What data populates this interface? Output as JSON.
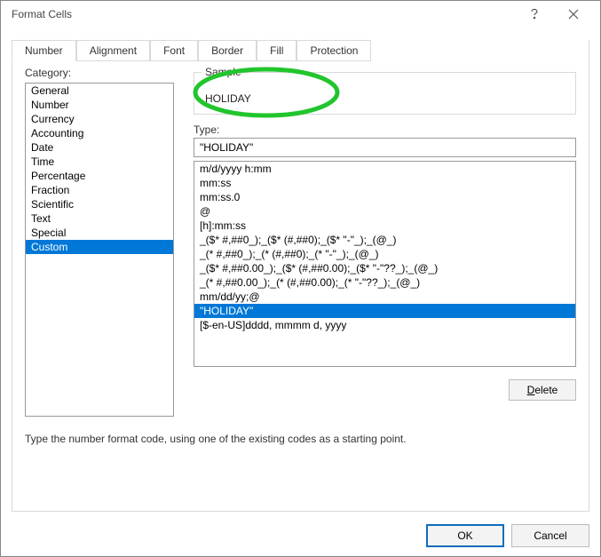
{
  "window": {
    "title": "Format Cells"
  },
  "tabs": {
    "number": "Number",
    "alignment": "Alignment",
    "font": "Font",
    "border": "Border",
    "fill": "Fill",
    "protection": "Protection"
  },
  "labels": {
    "category": "Category:",
    "sample": "Sample",
    "type": "Type:",
    "delete_d": "D",
    "delete_rest": "elete",
    "hint": "Type the number format code, using one of the existing codes as a starting point."
  },
  "sample": {
    "value": "HOLIDAY"
  },
  "type_value": "\"HOLIDAY\"",
  "categories": {
    "c0": "General",
    "c1": "Number",
    "c2": "Currency",
    "c3": "Accounting",
    "c4": "Date",
    "c5": "Time",
    "c6": "Percentage",
    "c7": "Fraction",
    "c8": "Scientific",
    "c9": "Text",
    "c10": "Special",
    "c11": "Custom"
  },
  "formats": {
    "f0": "m/d/yyyy h:mm",
    "f1": "mm:ss",
    "f2": "mm:ss.0",
    "f3": "@",
    "f4": "[h]:mm:ss",
    "f5": "_($* #,##0_);_($* (#,##0);_($* \"-\"_);_(@_)",
    "f6": "_(* #,##0_);_(* (#,##0);_(* \"-\"_);_(@_)",
    "f7": "_($* #,##0.00_);_($* (#,##0.00);_($* \"-\"??_);_(@_)",
    "f8": "_(* #,##0.00_);_(* (#,##0.00);_(* \"-\"??_);_(@_)",
    "f9": "mm/dd/yy;@",
    "f10": "\"HOLIDAY\"",
    "f11": "[$-en-US]dddd, mmmm d, yyyy"
  },
  "buttons": {
    "ok": "OK",
    "cancel": "Cancel"
  }
}
